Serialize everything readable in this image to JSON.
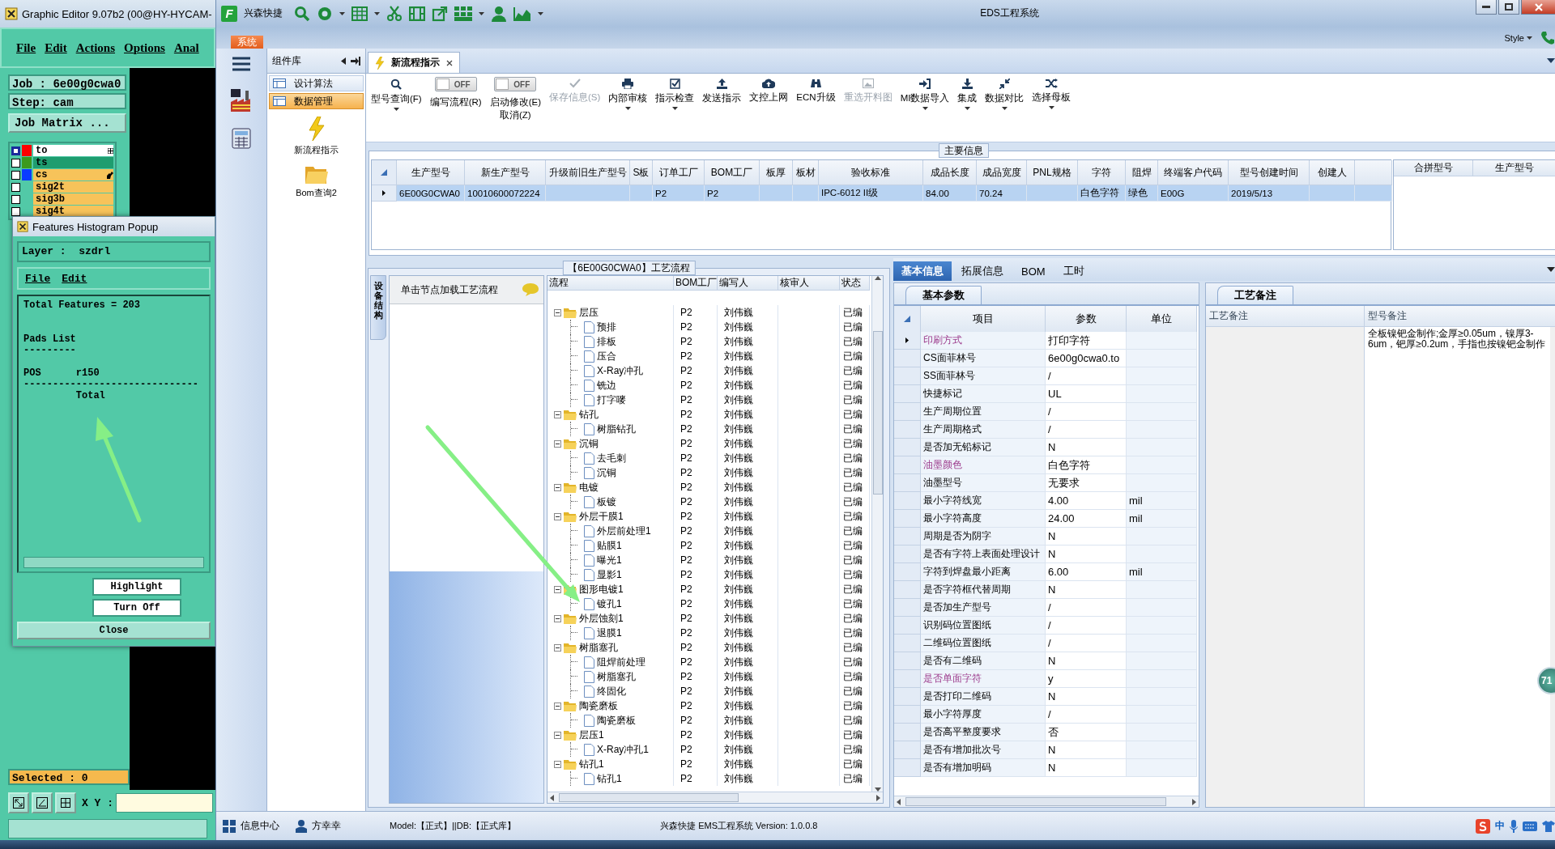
{
  "editor": {
    "title": "Graphic Editor 9.07b2 (00@HY-HYCAM-",
    "menu": [
      "File",
      "Edit",
      "Actions",
      "Options",
      "Anal"
    ],
    "job": "Job : 6e00g0cwa0",
    "step": "Step: cam",
    "job_matrix": "Job Matrix ...",
    "layers": [
      {
        "name": "to",
        "checked": true,
        "color": "#ff0000",
        "work": true,
        "displayed": false,
        "cursor": false
      },
      {
        "name": "ts",
        "checked": false,
        "color": "#3c9a1e",
        "work": false,
        "displayed": true,
        "cursor": false
      },
      {
        "name": "cs",
        "checked": false,
        "color": "#0a3cff",
        "work": false,
        "displayed": false,
        "cursor": true
      },
      {
        "name": "sig2t",
        "checked": false,
        "work": false,
        "displayed": false,
        "cursor": false
      },
      {
        "name": "sig3b",
        "checked": false,
        "work": false,
        "displayed": false,
        "cursor": false
      },
      {
        "name": "sig4t",
        "checked": false,
        "work": false,
        "displayed": false,
        "cursor": false
      }
    ],
    "popup": {
      "title": "Features Histogram Popup",
      "layer": "Layer :  szdrl",
      "menu": [
        "File",
        "Edit"
      ],
      "report": "Total Features = 203\n\n\nPads List\n---------\n\nPOS      r150\n------------------------------\n         Total",
      "buttons": [
        "Highlight",
        "Turn Off"
      ],
      "close": "Close"
    },
    "selected": "Selected : 0",
    "xy_label": "X Y :"
  },
  "eds": {
    "logo": "F",
    "app_name": "兴森快捷",
    "title": "EDS工程系统",
    "system_tab": "系统",
    "style_label": "Style",
    "nav_header": "组件库",
    "nav_items": [
      {
        "label": "设计算法",
        "selected": false
      },
      {
        "label": "数据管理",
        "selected": true
      }
    ],
    "shortcuts": [
      "新流程指示",
      "Bom查询2"
    ],
    "doc_tabs": [
      {
        "label": "新流程指示",
        "selected": true
      }
    ],
    "toolbar": [
      {
        "kind": "button",
        "label": "型号查询(F)",
        "disabled": false,
        "dropdown": true
      },
      {
        "kind": "toggle",
        "label": "编写流程(R)",
        "switch_text": "OFF",
        "on": false
      },
      {
        "kind": "toggle",
        "label": "启动修改(E)\n取消(Z)",
        "switch_text": "OFF",
        "on": false
      },
      {
        "kind": "button",
        "label": "保存信息(S)",
        "disabled": true,
        "dropdown": false
      },
      {
        "kind": "button",
        "label": "内部审核",
        "disabled": false,
        "dropdown": true
      },
      {
        "kind": "button",
        "label": "指示检查",
        "disabled": false,
        "dropdown": true
      },
      {
        "kind": "button",
        "label": "发送指示",
        "disabled": false,
        "dropdown": false
      },
      {
        "kind": "button",
        "label": "文控上网",
        "disabled": false,
        "dropdown": false
      },
      {
        "kind": "button",
        "label": "ECN升级",
        "disabled": false,
        "dropdown": false
      },
      {
        "kind": "button",
        "label": "重选开料图",
        "disabled": true,
        "dropdown": false
      },
      {
        "kind": "button",
        "label": "MI数据导入",
        "disabled": false,
        "dropdown": true
      },
      {
        "kind": "button",
        "label": "集成",
        "disabled": false,
        "dropdown": true
      },
      {
        "kind": "button",
        "label": "数据对比",
        "disabled": false,
        "dropdown": true
      },
      {
        "kind": "button",
        "label": "选择母板",
        "disabled": false,
        "dropdown": true
      }
    ],
    "main_info": {
      "title": "主要信息",
      "columns": [
        "生产型号",
        "新生产型号",
        "升级前旧生产型号",
        "S板",
        "订单工厂",
        "BOM工厂",
        "板厚",
        "板材",
        "验收标准",
        "成品长度",
        "成品宽度",
        "PNL规格",
        "字符",
        "阻焊",
        "终端客户代码",
        "型号创建时间",
        "创建人"
      ],
      "rows": [
        {
          "cells": [
            "6E00G0CWA0",
            "10010600072224",
            null,
            null,
            "P2",
            "P2",
            null,
            null,
            "IPC-6012 II级",
            "84.00",
            "70.24",
            null,
            "白色字符",
            "绿色",
            "E00G",
            "2019/5/13",
            null
          ],
          "selected": true
        }
      ],
      "side_columns": [
        "合拼型号",
        "生产型号"
      ]
    },
    "flow": {
      "title": "【6E00G0CWA0】工艺流程",
      "side_tab": "设备结构",
      "hint": "单击节点加载工艺流程",
      "columns": [
        "流程",
        "BOM工厂",
        "编写人",
        "核审人",
        "状态"
      ],
      "rows": [
        {
          "name": "层压",
          "bom": "P2",
          "author": "刘伟巍",
          "status": "已编",
          "expanded": true,
          "children": [
            {
              "name": "预排",
              "bom": "P2",
              "author": "刘伟巍",
              "status": "已编"
            },
            {
              "name": "排板",
              "bom": "P2",
              "author": "刘伟巍",
              "status": "已编"
            },
            {
              "name": "压合",
              "bom": "P2",
              "author": "刘伟巍",
              "status": "已编"
            },
            {
              "name": "X-Ray冲孔",
              "bom": "P2",
              "author": "刘伟巍",
              "status": "已编"
            },
            {
              "name": "铣边",
              "bom": "P2",
              "author": "刘伟巍",
              "status": "已编"
            },
            {
              "name": "打字嘜",
              "bom": "P2",
              "author": "刘伟巍",
              "status": "已编"
            }
          ]
        },
        {
          "name": "钻孔",
          "bom": "P2",
          "author": "刘伟巍",
          "status": "已编",
          "expanded": true,
          "children": [
            {
              "name": "树脂钻孔",
              "bom": "P2",
              "author": "刘伟巍",
              "status": "已编"
            }
          ]
        },
        {
          "name": "沉铜",
          "bom": "P2",
          "author": "刘伟巍",
          "status": "已编",
          "expanded": true,
          "children": [
            {
              "name": "去毛刺",
              "bom": "P2",
              "author": "刘伟巍",
              "status": "已编"
            },
            {
              "name": "沉铜",
              "bom": "P2",
              "author": "刘伟巍",
              "status": "已编"
            }
          ]
        },
        {
          "name": "电镀",
          "bom": "P2",
          "author": "刘伟巍",
          "status": "已编",
          "expanded": true,
          "children": [
            {
              "name": "板镀",
              "bom": "P2",
              "author": "刘伟巍",
              "status": "已编"
            }
          ]
        },
        {
          "name": "外层干膜1",
          "bom": "P2",
          "author": "刘伟巍",
          "status": "已编",
          "expanded": true,
          "children": [
            {
              "name": "外层前处理1",
              "bom": "P2",
              "author": "刘伟巍",
              "status": "已编"
            },
            {
              "name": "贴膜1",
              "bom": "P2",
              "author": "刘伟巍",
              "status": "已编"
            },
            {
              "name": "曝光1",
              "bom": "P2",
              "author": "刘伟巍",
              "status": "已编"
            },
            {
              "name": "显影1",
              "bom": "P2",
              "author": "刘伟巍",
              "status": "已编"
            }
          ]
        },
        {
          "name": "图形电镀1",
          "bom": "P2",
          "author": "刘伟巍",
          "status": "已编",
          "expanded": true,
          "children": [
            {
              "name": "镀孔1",
              "bom": "P2",
              "author": "刘伟巍",
              "status": "已编"
            }
          ]
        },
        {
          "name": "外层蚀刻1",
          "bom": "P2",
          "author": "刘伟巍",
          "status": "已编",
          "expanded": true,
          "children": [
            {
              "name": "退膜1",
              "bom": "P2",
              "author": "刘伟巍",
              "status": "已编"
            }
          ]
        },
        {
          "name": "树脂塞孔",
          "bom": "P2",
          "author": "刘伟巍",
          "status": "已编",
          "expanded": true,
          "children": [
            {
              "name": "阻焊前处理",
              "bom": "P2",
              "author": "刘伟巍",
              "status": "已编"
            },
            {
              "name": "树脂塞孔",
              "bom": "P2",
              "author": "刘伟巍",
              "status": "已编"
            },
            {
              "name": "终固化",
              "bom": "P2",
              "author": "刘伟巍",
              "status": "已编"
            }
          ]
        },
        {
          "name": "陶瓷磨板",
          "bom": "P2",
          "author": "刘伟巍",
          "status": "已编",
          "expanded": true,
          "children": [
            {
              "name": "陶瓷磨板",
              "bom": "P2",
              "author": "刘伟巍",
              "status": "已编"
            }
          ]
        },
        {
          "name": "层压1",
          "bom": "P2",
          "author": "刘伟巍",
          "status": "已编",
          "expanded": true,
          "children": [
            {
              "name": "X-Ray冲孔1",
              "bom": "P2",
              "author": "刘伟巍",
              "status": "已编"
            }
          ]
        },
        {
          "name": "钻孔1",
          "bom": "P2",
          "author": "刘伟巍",
          "status": "已编",
          "expanded": true,
          "children": [
            {
              "name": "钻孔1",
              "bom": "P2",
              "author": "刘伟巍",
              "status": "已编"
            }
          ]
        }
      ]
    },
    "detail": {
      "tabs": [
        {
          "label": "基本信息",
          "selected": true
        },
        {
          "label": "拓展信息",
          "selected": false
        },
        {
          "label": "BOM",
          "selected": false
        },
        {
          "label": "工时",
          "selected": false
        }
      ],
      "params_title": "基本参数",
      "param_columns": [
        "项目",
        "参数",
        "单位"
      ],
      "params": [
        {
          "name": "印刷方式",
          "value": "打印字符",
          "highlighted": true,
          "selected": true
        },
        {
          "name": "CS面菲林号",
          "value": "6e00g0cwa0.to",
          "highlighted": false,
          "selected": false
        },
        {
          "name": "SS面菲林号",
          "value": "/",
          "highlighted": false,
          "selected": false
        },
        {
          "name": "快捷标记",
          "value": "UL",
          "highlighted": false,
          "selected": false
        },
        {
          "name": "生产周期位置",
          "value": "/",
          "highlighted": false,
          "selected": false
        },
        {
          "name": "生产周期格式",
          "value": "/",
          "highlighted": false,
          "selected": false
        },
        {
          "name": "是否加无铅标记",
          "value": "N",
          "highlighted": false,
          "selected": false
        },
        {
          "name": "油墨颜色",
          "value": "白色字符",
          "highlighted": true,
          "selected": false
        },
        {
          "name": "油墨型号",
          "value": "无要求",
          "highlighted": false,
          "selected": false
        },
        {
          "name": "最小字符线宽",
          "value": "4.00",
          "unit": "mil",
          "highlighted": false,
          "selected": false
        },
        {
          "name": "最小字符高度",
          "value": "24.00",
          "unit": "mil",
          "highlighted": false,
          "selected": false
        },
        {
          "name": "周期是否为阴字",
          "value": "N",
          "highlighted": false,
          "selected": false
        },
        {
          "name": "是否有字符上表面处理设计",
          "value": "N",
          "highlighted": false,
          "selected": false
        },
        {
          "name": "字符到焊盘最小距离",
          "value": "6.00",
          "unit": "mil",
          "highlighted": false,
          "selected": false
        },
        {
          "name": "是否字符框代替周期",
          "value": "N",
          "highlighted": false,
          "selected": false
        },
        {
          "name": "是否加生产型号",
          "value": "/",
          "highlighted": false,
          "selected": false
        },
        {
          "name": "识别码位置图纸",
          "value": "/",
          "highlighted": false,
          "selected": false
        },
        {
          "name": "二维码位置图纸",
          "value": "/",
          "highlighted": false,
          "selected": false
        },
        {
          "name": "是否有二维码",
          "value": "N",
          "highlighted": false,
          "selected": false
        },
        {
          "name": "是否单面字符",
          "value": "y",
          "highlighted": true,
          "selected": false
        },
        {
          "name": "是否打印二维码",
          "value": "N",
          "highlighted": false,
          "selected": false
        },
        {
          "name": "最小字符厚度",
          "value": "/",
          "highlighted": false,
          "selected": false
        },
        {
          "name": "是否高平整度要求",
          "value": "否",
          "highlighted": false,
          "selected": false
        },
        {
          "name": "是否有增加批次号",
          "value": "N",
          "highlighted": false,
          "selected": false
        },
        {
          "name": "是否有增加明码",
          "value": "N",
          "highlighted": false,
          "selected": false
        }
      ],
      "notes_title": "工艺备注",
      "note_columns": [
        "工艺备注",
        "型号备注"
      ],
      "model_note": "全板镍钯金制作;金厚≥0.05um，镍厚3-6um，钯厚≥0.2um，手指也按镍钯金制作"
    },
    "status": {
      "info_center": "信息中心",
      "user": "方幸幸",
      "env": "Model:【正式】||DB:【正式库】",
      "version": "兴森快捷 EMS工程系统 Version: 1.0.0.8",
      "ime": "中"
    },
    "badge": "71"
  }
}
